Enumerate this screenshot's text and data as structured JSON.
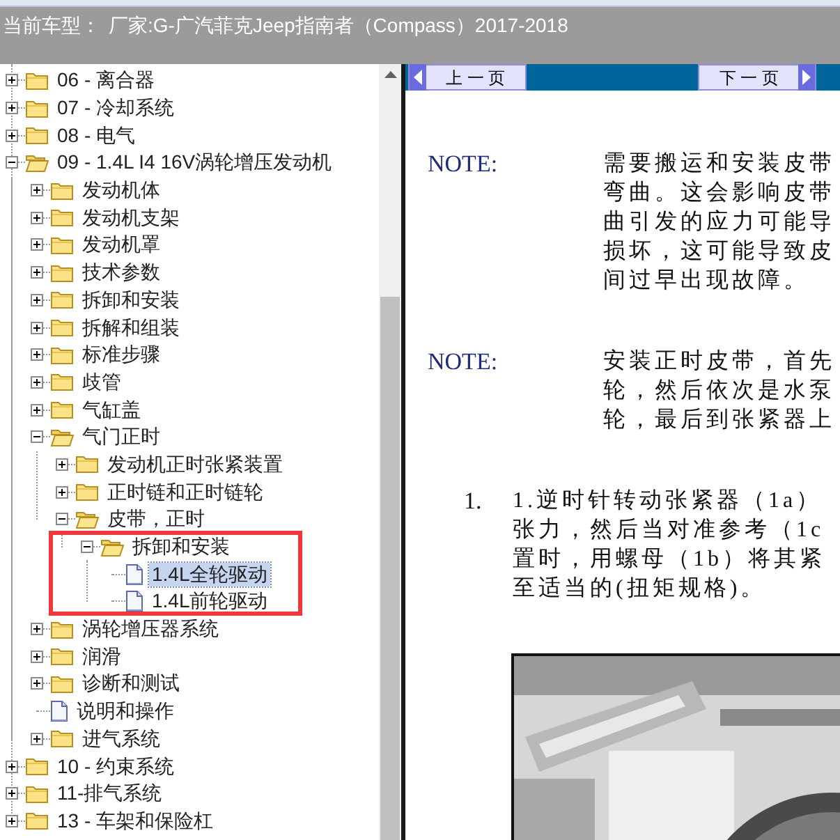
{
  "header": {
    "label": "当前车型：",
    "value": "厂家:G-广汽菲克Jeep指南者（Compass）2017-2018"
  },
  "tree": [
    {
      "label": "06 - 离合器",
      "kind": "folder",
      "expanded": false,
      "selected": false
    },
    {
      "label": "07 - 冷却系统",
      "kind": "folder",
      "expanded": false,
      "selected": false
    },
    {
      "label": "08 - 电气",
      "kind": "folder",
      "expanded": false,
      "selected": false
    },
    {
      "label": "09 - 1.4L I4 16V涡轮增压发动机",
      "kind": "folder",
      "expanded": true,
      "selected": false,
      "children": [
        {
          "label": "发动机体",
          "kind": "folder",
          "expanded": false,
          "selected": false
        },
        {
          "label": "发动机支架",
          "kind": "folder",
          "expanded": false,
          "selected": false
        },
        {
          "label": "发动机罩",
          "kind": "folder",
          "expanded": false,
          "selected": false
        },
        {
          "label": "技术参数",
          "kind": "folder",
          "expanded": false,
          "selected": false
        },
        {
          "label": "拆卸和安装",
          "kind": "folder",
          "expanded": false,
          "selected": false
        },
        {
          "label": "拆解和组装",
          "kind": "folder",
          "expanded": false,
          "selected": false
        },
        {
          "label": "标准步骤",
          "kind": "folder",
          "expanded": false,
          "selected": false
        },
        {
          "label": "歧管",
          "kind": "folder",
          "expanded": false,
          "selected": false
        },
        {
          "label": "气缸盖",
          "kind": "folder",
          "expanded": false,
          "selected": false
        },
        {
          "label": "气门正时",
          "kind": "folder",
          "expanded": true,
          "selected": false,
          "children": [
            {
              "label": "发动机正时张紧装置",
              "kind": "folder",
              "expanded": false,
              "selected": false
            },
            {
              "label": "正时链和正时链轮",
              "kind": "folder",
              "expanded": false,
              "selected": false
            },
            {
              "label": "皮带，正时",
              "kind": "folder",
              "expanded": true,
              "selected": false,
              "children": [
                {
                  "label": "拆卸和安装",
                  "kind": "folder",
                  "expanded": true,
                  "selected": false,
                  "children": [
                    {
                      "label": "1.4L全轮驱动",
                      "kind": "document",
                      "selected": true
                    },
                    {
                      "label": "1.4L前轮驱动",
                      "kind": "document",
                      "selected": false
                    }
                  ]
                }
              ]
            }
          ]
        },
        {
          "label": "涡轮增压器系统",
          "kind": "folder",
          "expanded": false,
          "selected": false
        },
        {
          "label": "润滑",
          "kind": "folder",
          "expanded": false,
          "selected": false
        },
        {
          "label": "诊断和测试",
          "kind": "folder",
          "expanded": false,
          "selected": false
        },
        {
          "label": "说明和操作",
          "kind": "document",
          "selected": false
        },
        {
          "label": "进气系统",
          "kind": "folder",
          "expanded": false,
          "selected": false
        }
      ]
    },
    {
      "label": "10 - 约束系统",
      "kind": "folder",
      "expanded": false,
      "selected": false
    },
    {
      "label": "11-排气系统",
      "kind": "folder",
      "expanded": false,
      "selected": false
    },
    {
      "label": "13 - 车架和保险杠",
      "kind": "folder",
      "expanded": false,
      "selected": false
    }
  ],
  "nav": {
    "previous": "上 一 页",
    "next": "下 一 页"
  },
  "content": [
    {
      "kind": "note",
      "label": "NOTE:",
      "lines": [
        "需要搬运和安装皮带",
        "弯曲。这会影响皮带",
        "曲引发的应力可能导",
        "损坏，这可能导致皮",
        "间过早出现故障。"
      ]
    },
    {
      "kind": "note",
      "label": "NOTE:",
      "lines": [
        "安装正时皮带，首先",
        "轮，然后依次是水泵",
        "轮，最后到张紧器上"
      ]
    },
    {
      "kind": "step",
      "label": "1.",
      "lines": [
        "1.逆时针转动张紧器（1a）",
        "张力，然后当对准参考（1c",
        "置时，用螺母（1b）将其紧",
        "至适当的(扭矩规格)。"
      ]
    },
    {
      "kind": "picture"
    }
  ]
}
